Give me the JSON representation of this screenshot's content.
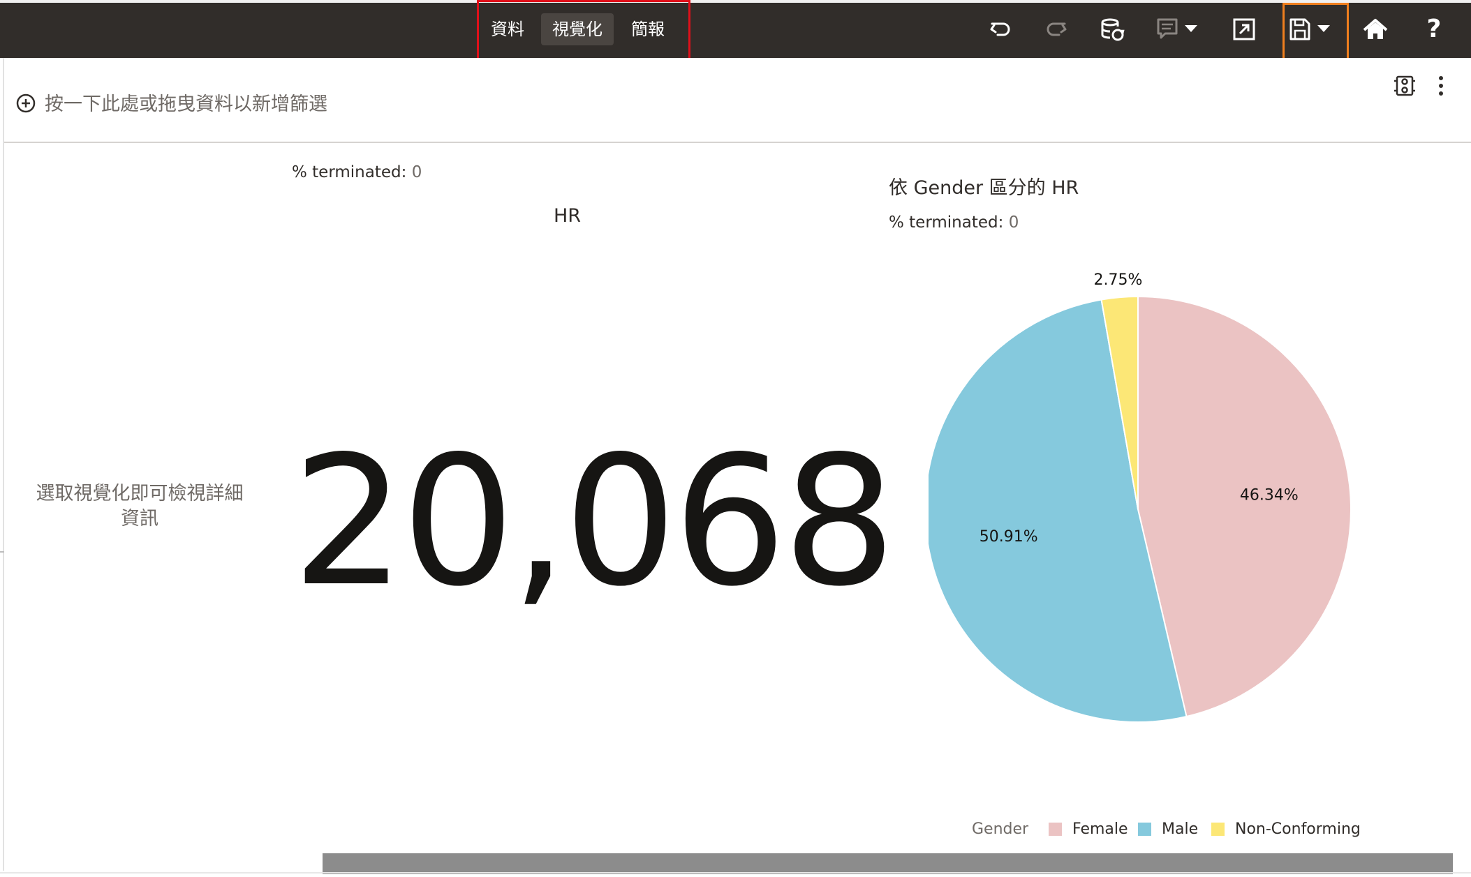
{
  "toolbar": {
    "tabs": [
      {
        "label": "資料",
        "active": false
      },
      {
        "label": "視覺化",
        "active": true
      },
      {
        "label": "簡報",
        "active": false
      }
    ],
    "icons": [
      "undo-icon",
      "redo-icon",
      "data-refresh-icon",
      "comment-icon",
      "present-icon",
      "save-icon",
      "home-icon",
      "help-icon"
    ],
    "help_glyph": "?"
  },
  "filterbar": {
    "placeholder": "按一下此處或拖曳資料以新增篩選"
  },
  "hint": {
    "text": "選取視覺化即可檢視詳細資訊"
  },
  "tile": {
    "measure_label": "% terminated:",
    "measure_value": "0",
    "title": "HR",
    "value": "20,068"
  },
  "pie": {
    "title": "依 Gender 區分的 HR",
    "measure_label": "% terminated:",
    "measure_value": "0"
  },
  "legend": {
    "title": "Gender",
    "items": [
      {
        "label": "Female",
        "color": "#ebc3c3"
      },
      {
        "label": "Male",
        "color": "#85c9dd"
      },
      {
        "label": "Non-Conforming",
        "color": "#fce776"
      }
    ]
  },
  "colors": {
    "toolbar_bg": "#312d2a",
    "tabs_highlight": "#e0101a",
    "save_highlight": "#f07f1e"
  },
  "chart_data": {
    "type": "pie",
    "categories": [
      "Female",
      "Male",
      "Non-Conforming"
    ],
    "values": [
      46.34,
      50.91,
      2.75
    ],
    "labels": [
      "46.34%",
      "50.91%",
      "2.75%"
    ],
    "colors": [
      "#ebc3c3",
      "#85c9dd",
      "#fce776"
    ],
    "title": "依 Gender 區分的 HR",
    "legend_position": "bottom-right"
  }
}
